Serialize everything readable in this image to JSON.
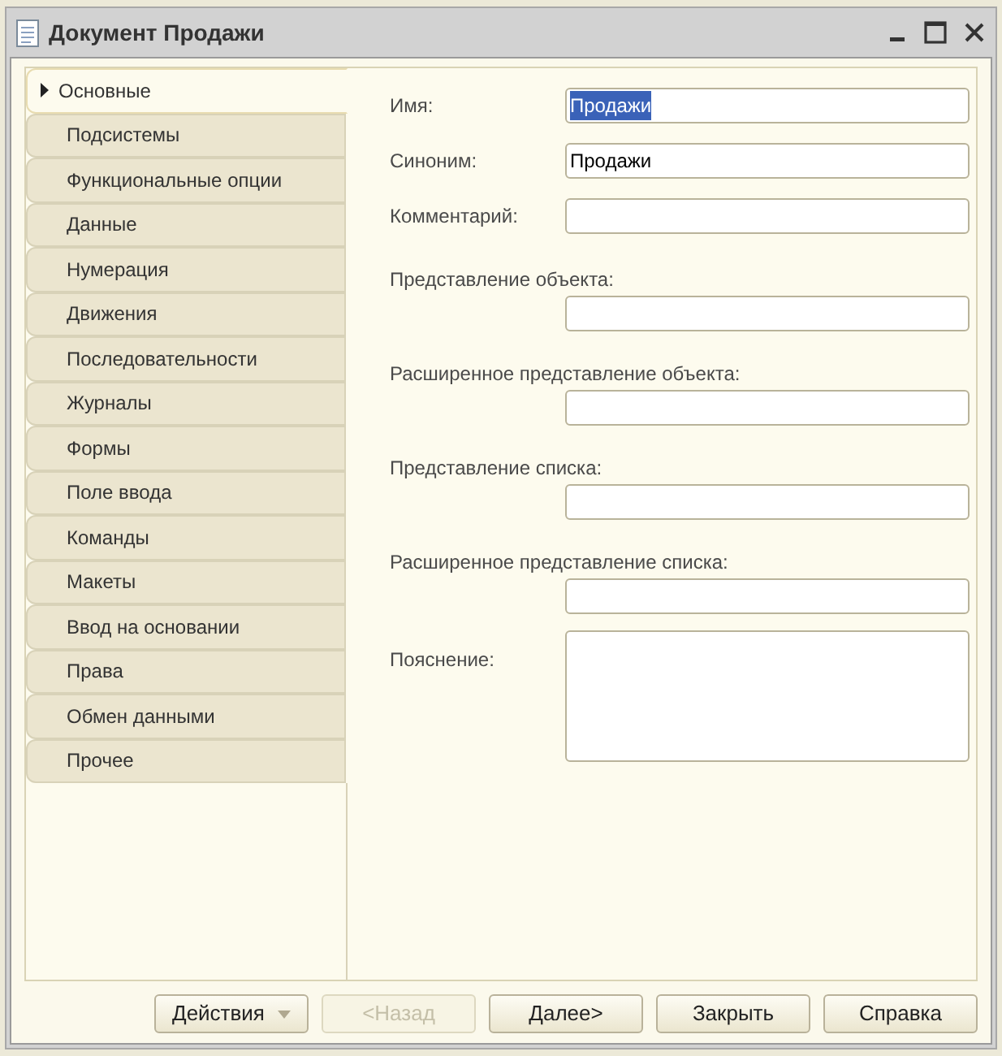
{
  "window": {
    "title": "Документ Продажи"
  },
  "tabs": [
    {
      "label": "Основные",
      "selected": true
    },
    {
      "label": "Подсистемы",
      "selected": false
    },
    {
      "label": "Функциональные опции",
      "selected": false
    },
    {
      "label": "Данные",
      "selected": false
    },
    {
      "label": "Нумерация",
      "selected": false
    },
    {
      "label": "Движения",
      "selected": false
    },
    {
      "label": "Последовательности",
      "selected": false
    },
    {
      "label": "Журналы",
      "selected": false
    },
    {
      "label": "Формы",
      "selected": false
    },
    {
      "label": "Поле ввода",
      "selected": false
    },
    {
      "label": "Команды",
      "selected": false
    },
    {
      "label": "Макеты",
      "selected": false
    },
    {
      "label": "Ввод на основании",
      "selected": false
    },
    {
      "label": "Права",
      "selected": false
    },
    {
      "label": "Обмен данными",
      "selected": false
    },
    {
      "label": "Прочее",
      "selected": false
    }
  ],
  "fields": [
    {
      "kind": "inline",
      "label": "Имя:",
      "value": "Продажи",
      "highlighted": true
    },
    {
      "kind": "inline",
      "label": "Синоним:",
      "value": "Продажи",
      "highlighted": false
    },
    {
      "kind": "inline",
      "label": "Комментарий:"
    },
    {
      "kind": "stacked",
      "label": "Представление объекта:"
    },
    {
      "kind": "stacked",
      "label": "Расширенное представление объекта:"
    },
    {
      "kind": "stacked",
      "label": "Представление списка:"
    },
    {
      "kind": "stacked",
      "label": "Расширенное представление списка:"
    },
    {
      "kind": "textarea",
      "label": "Пояснение:"
    }
  ],
  "buttons": [
    {
      "label": "Действия",
      "kind": "menu",
      "disabled": false
    },
    {
      "label": "<Назад",
      "kind": "plain",
      "disabled": true
    },
    {
      "label": "Далее>",
      "kind": "plain",
      "disabled": false
    },
    {
      "label": "Закрыть",
      "kind": "plain",
      "disabled": false
    },
    {
      "label": "Справка",
      "kind": "plain",
      "disabled": false
    }
  ]
}
